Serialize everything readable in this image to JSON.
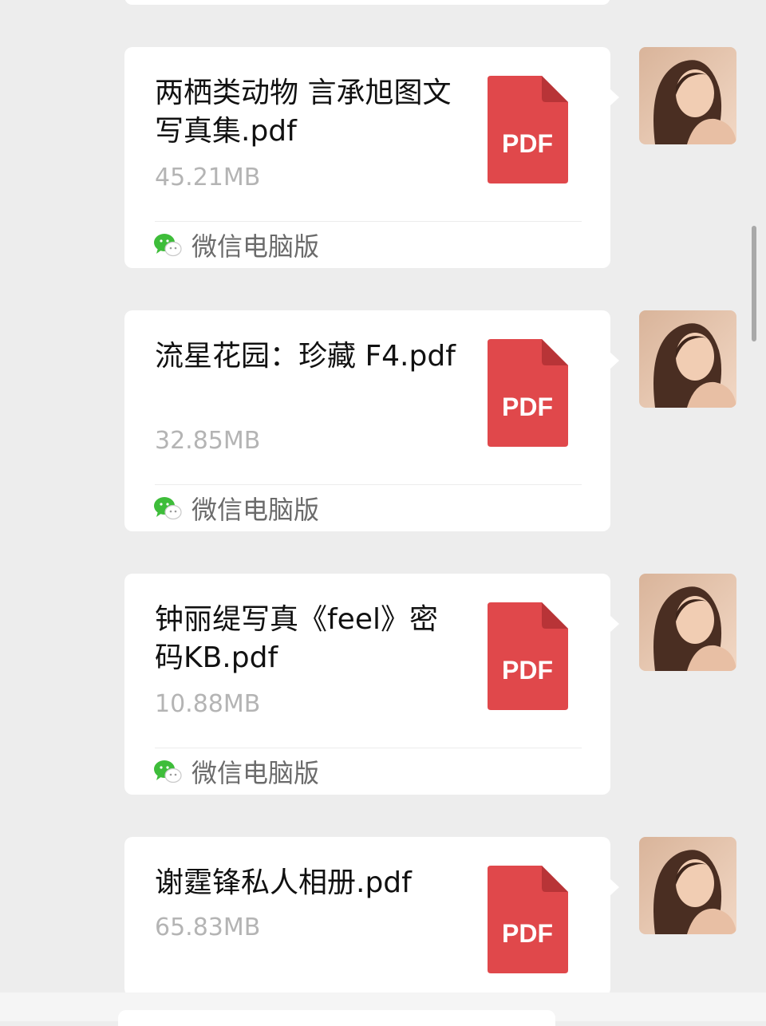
{
  "messages": [
    {
      "name": "两栖类动物 言承旭图文写真集.pdf",
      "size": "45.21MB",
      "source": "微信电脑版",
      "file_type": "PDF"
    },
    {
      "name": "流星花园：珍藏 F4.pdf",
      "size": "32.85MB",
      "source": "微信电脑版",
      "file_type": "PDF"
    },
    {
      "name": "钟丽缇写真《feel》密码KB.pdf",
      "size": "10.88MB",
      "source": "微信电脑版",
      "file_type": "PDF"
    },
    {
      "name": "谢霆锋私人相册.pdf",
      "size": "65.83MB",
      "file_type": "PDF"
    }
  ],
  "icons": {
    "file": "pdf-file-icon",
    "source": "wechat-icon",
    "avatar": "avatar"
  },
  "colors": {
    "pdf_red": "#e0484b",
    "wechat_green": "#3ebd3a",
    "background": "#ededed"
  }
}
